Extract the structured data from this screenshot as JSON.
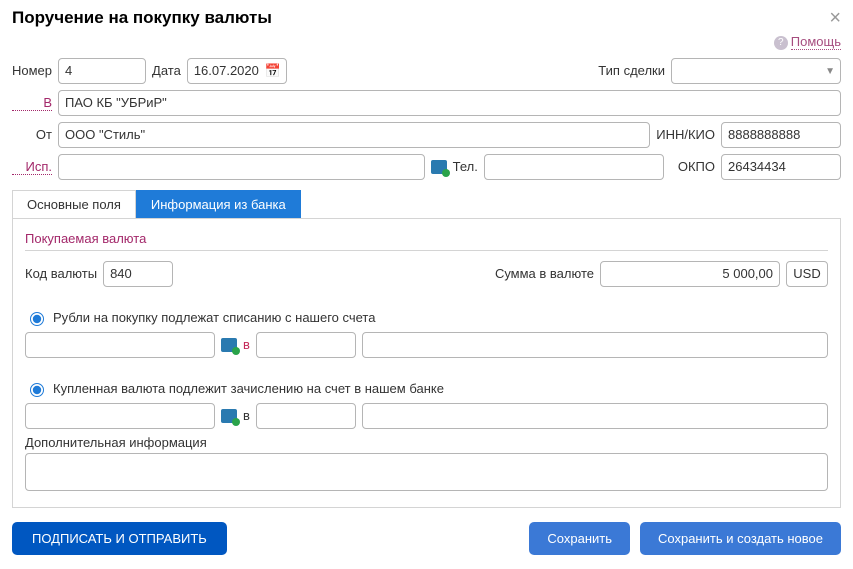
{
  "dialog": {
    "title": "Поручение на покупку валюты",
    "help": "Помощь"
  },
  "header": {
    "number_label": "Номер",
    "number": "4",
    "date_label": "Дата",
    "date": "16.07.2020",
    "deal_type_label": "Тип сделки",
    "deal_type": ""
  },
  "bank": {
    "b_label": "В",
    "bank_name": "ПАО КБ \"УБРиР\"",
    "from_label": "От",
    "from_name": "ООО \"Стиль\"",
    "inn_label": "ИНН/КИО",
    "inn": "8888888888",
    "isp_label": "Исп.",
    "isp": "",
    "tel_label": "Тел.",
    "tel": "",
    "okpo_label": "ОКПО",
    "okpo": "26434434"
  },
  "tabs": {
    "main": "Основные поля",
    "bank_info": "Информация из банка"
  },
  "currency": {
    "section_title": "Покупаемая валюта",
    "code_label": "Код валюты",
    "code": "840",
    "sum_label": "Сумма в валюте",
    "sum": "5 000,00",
    "unit": "USD"
  },
  "rubles": {
    "radio_label": "Рубли на покупку подлежат списанию с нашего счета",
    "v_label": "в",
    "acct": "",
    "bank_code": "",
    "bank_name_field": ""
  },
  "bought": {
    "radio_label": "Купленная валюта подлежит зачислению на счет в нашем банке",
    "v_label": "в",
    "acct": "",
    "bank_code": "",
    "bank_name_field": ""
  },
  "extra": {
    "label": "Дополнительная информация",
    "value": ""
  },
  "buttons": {
    "sign_send": "ПОДПИСАТЬ И ОТПРАВИТЬ",
    "save": "Сохранить",
    "save_new": "Сохранить и создать новое"
  }
}
